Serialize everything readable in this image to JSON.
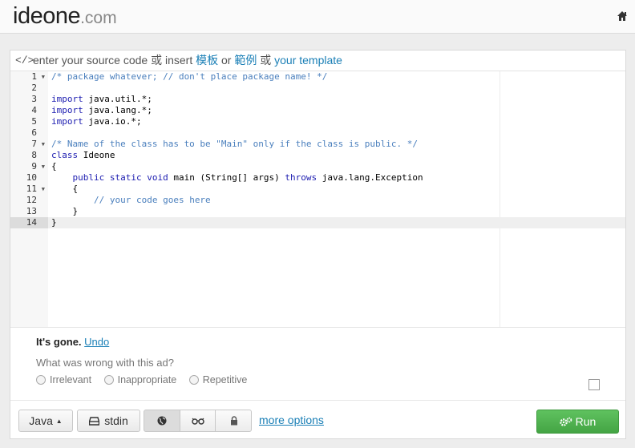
{
  "brand": {
    "name": "ideone",
    "suffix": ".com"
  },
  "header": {
    "home_icon": "home-icon"
  },
  "panel": {
    "prompt_prefix": "enter your source code 或 insert",
    "link_template_zh1": "模板",
    "or_text": "or",
    "link_template_zh2": "範例",
    "or_text2": "或",
    "link_your_template": "your template"
  },
  "editor": {
    "language": "Java",
    "active_line": 14,
    "lines": [
      {
        "n": "1",
        "fold": true
      },
      {
        "n": "2"
      },
      {
        "n": "3"
      },
      {
        "n": "4"
      },
      {
        "n": "5"
      },
      {
        "n": "6"
      },
      {
        "n": "7",
        "fold": true
      },
      {
        "n": "8"
      },
      {
        "n": "9",
        "fold": true
      },
      {
        "n": "10"
      },
      {
        "n": "11",
        "fold": true
      },
      {
        "n": "12"
      },
      {
        "n": "13"
      },
      {
        "n": "14"
      }
    ],
    "code": {
      "l1": "/* package whatever; // don't place package name! */",
      "l3_kw": "import",
      "l3_rest": " java.util.*;",
      "l4_kw": "import",
      "l4_rest": " java.lang.*;",
      "l5_kw": "import",
      "l5_rest": " java.io.*;",
      "l7": "/* Name of the class has to be \"Main\" only if the class is public. */",
      "l8_kw": "class",
      "l8_rest": " Ideone",
      "l9": "{",
      "l10_indent": "    ",
      "l10_kw1": "public static void",
      "l10_mid": " main (String[] args) ",
      "l10_kw2": "throws",
      "l10_rest": " java.lang.Exception",
      "l11": "    {",
      "l12_indent": "        ",
      "l12": "// your code goes here",
      "l13": "    }",
      "l14": "}"
    }
  },
  "ad": {
    "gone": "It's gone.",
    "undo": "Undo",
    "question": "What was wrong with this ad?",
    "options": [
      "Irrelevant",
      "Inappropriate",
      "Repetitive"
    ]
  },
  "toolbar": {
    "language_button": "Java",
    "stdin_button": "stdin",
    "more_options": "more options",
    "run_button": "Run"
  },
  "colors": {
    "accent": "#1a7fb6",
    "run": "#4cae4c"
  }
}
